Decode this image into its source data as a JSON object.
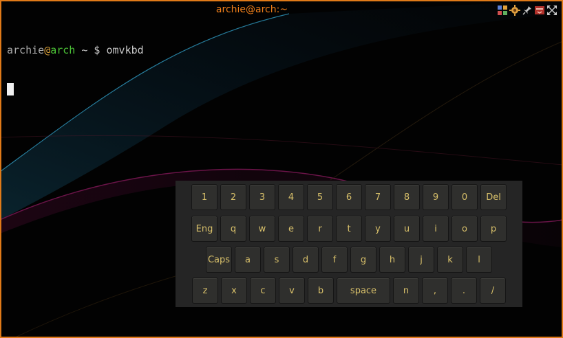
{
  "window": {
    "title": "archie@arch:~",
    "frame_color": "#e07a18",
    "titlebar_icons": [
      "layout-grid-icon",
      "settings-gear-icon",
      "pin-icon",
      "minimize-icon",
      "maximize-icon"
    ]
  },
  "terminal": {
    "user": "archie",
    "at": "@",
    "host": "arch",
    "path_prompt": " ~ $ ",
    "command": "omvkbd"
  },
  "keyboard": {
    "row1": [
      "1",
      "2",
      "3",
      "4",
      "5",
      "6",
      "7",
      "8",
      "9",
      "0",
      "Del"
    ],
    "row2": [
      "Eng",
      "q",
      "w",
      "e",
      "r",
      "t",
      "y",
      "u",
      "i",
      "o",
      "p"
    ],
    "row3": [
      "Caps",
      "a",
      "s",
      "d",
      "f",
      "g",
      "h",
      "j",
      "k",
      "l"
    ],
    "row4": [
      "z",
      "x",
      "c",
      "v",
      "b",
      "space",
      "n",
      ",",
      ".",
      "/"
    ]
  },
  "colors": {
    "key_text": "#d8c06a",
    "key_bg": "#2f2f2d",
    "panel_bg": "#252525",
    "host_green": "#4cc437",
    "at_orange": "#d8a03a"
  }
}
